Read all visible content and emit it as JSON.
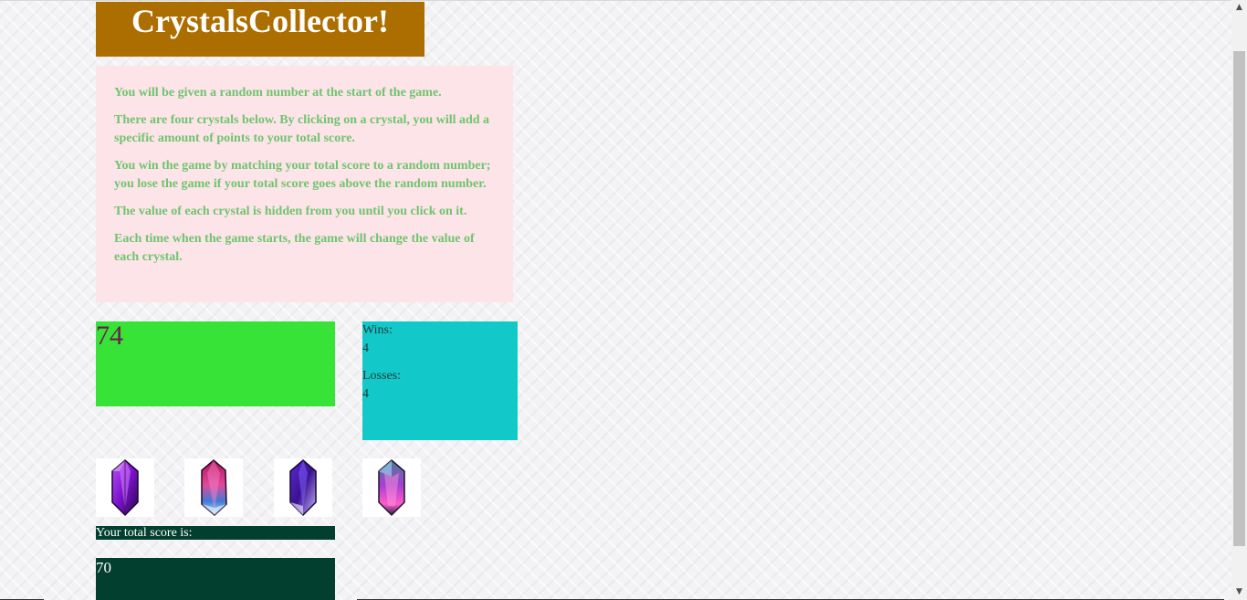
{
  "game": {
    "title": "CrystalsCollector!",
    "instructions": [
      "You will be given a random number at the start of the game.",
      "There are four crystals below. By clicking on a crystal, you will add a specific amount of points to your total score.",
      "You win the game by matching your total score to a random number; you lose the game if your total score goes above the random number.",
      "The value of each crystal is hidden from you until you click on it.",
      "Each time when the game starts, the game will change the value of each crystal."
    ],
    "target_number": "74",
    "stats": {
      "wins_label": "Wins:",
      "wins_value": "4",
      "losses_label": "Losses:",
      "losses_value": "4"
    },
    "crystals": [
      {
        "name": "purple-crystal",
        "icon": "crystal-icon"
      },
      {
        "name": "pink-blue-crystal",
        "icon": "crystal-icon"
      },
      {
        "name": "violet-crystal",
        "icon": "crystal-icon"
      },
      {
        "name": "magenta-crystal",
        "icon": "crystal-icon"
      }
    ],
    "score_label": "Your total score is:",
    "total_score": "70"
  },
  "colors": {
    "title_bg": "#ad6e00",
    "instructions_bg": "#fde4e8",
    "instructions_text": "#6fc46f",
    "target_bg": "#36e336",
    "target_text": "#6a1f4d",
    "stats_bg": "#13c8c8",
    "score_bg": "#033f2e"
  }
}
